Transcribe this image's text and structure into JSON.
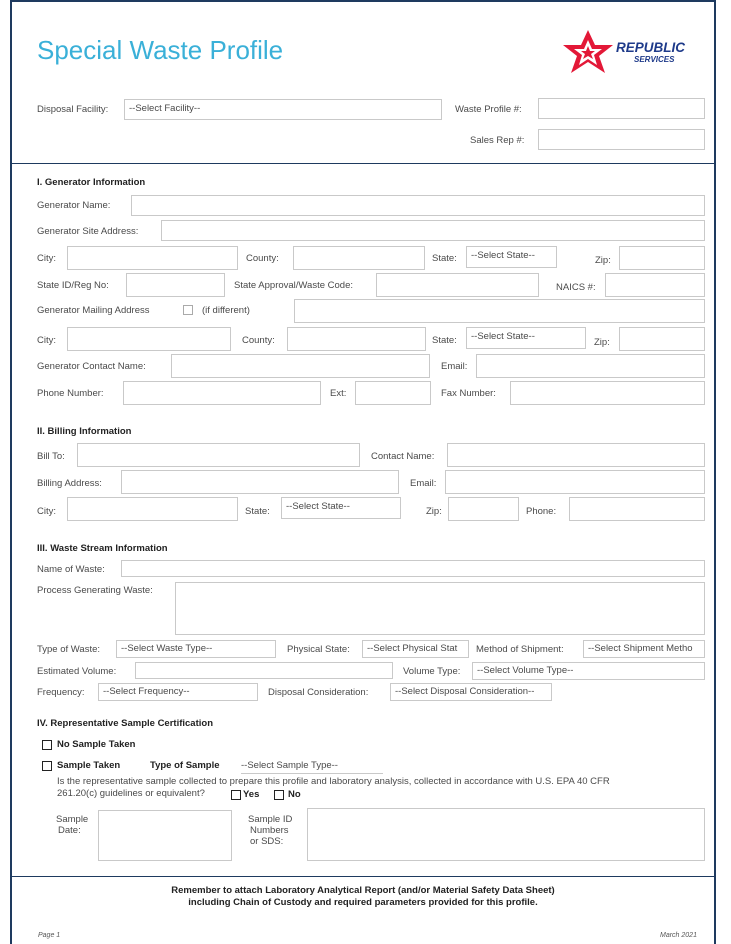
{
  "header": {
    "title": "Special Waste Profile",
    "logo_text_1": "REPUBLIC",
    "logo_text_2": "SERVICES",
    "disposal_facility_label": "Disposal Facility:",
    "disposal_facility_value": "--Select Facility--",
    "waste_profile_label": "Waste Profile #:",
    "sales_rep_label": "Sales Rep #:"
  },
  "generator": {
    "heading": "I. Generator Information",
    "name_label": "Generator Name:",
    "site_address_label": "Generator Site Address:",
    "city_label": "City:",
    "county_label": "County:",
    "state_label": "State:",
    "state_value": "--Select State--",
    "zip_label": "Zip:",
    "state_id_label": "State ID/Reg No:",
    "state_approval_label": "State Approval/Waste Code:",
    "naics_label": "NAICS #:",
    "mailing_label": "Generator Mailing Address",
    "if_different_label": "(if different)",
    "city2_label": "City:",
    "county2_label": "County:",
    "state2_label": "State:",
    "state2_value": "--Select State--",
    "zip2_label": "Zip:",
    "contact_label": "Generator Contact Name:",
    "email_label": "Email:",
    "phone_label": "Phone Number:",
    "ext_label": "Ext:",
    "fax_label": "Fax Number:"
  },
  "billing": {
    "heading": "II. Billing Information",
    "bill_to_label": "Bill To:",
    "contact_label": "Contact Name:",
    "address_label": "Billing Address:",
    "email_label": "Email:",
    "city_label": "City:",
    "state_label": "State:",
    "state_value": "--Select State--",
    "zip_label": "Zip:",
    "phone_label": "Phone:"
  },
  "waste_stream": {
    "heading": "III. Waste Stream Information",
    "name_label": "Name of Waste:",
    "process_label": "Process Generating Waste:",
    "type_label": "Type of Waste:",
    "type_value": "--Select Waste Type--",
    "physical_label": "Physical State:",
    "physical_value": "--Select Physical Stat",
    "shipment_label": "Method of Shipment:",
    "shipment_value": "--Select Shipment Metho",
    "volume_label": "Estimated Volume:",
    "volume_type_label": "Volume Type:",
    "volume_type_value": "--Select Volume Type--",
    "frequency_label": "Frequency:",
    "frequency_value": "--Select Frequency--",
    "disposal_label": "Disposal Consideration:",
    "disposal_value": "--Select Disposal Consideration--"
  },
  "sample": {
    "heading": "IV. Representative Sample Certification",
    "no_sample_label": "No Sample Taken",
    "sample_taken_label": "Sample Taken",
    "type_label": "Type of Sample",
    "type_value": "--Select Sample Type--",
    "question_line1": "Is the representative sample collected to prepare this profile and laboratory analysis, collected in accordance with U.S. EPA 40 CFR",
    "question_line2": "261.20(c) guidelines or equivalent?",
    "yes_label": "Yes",
    "no_label": "No",
    "date_label_1": "Sample",
    "date_label_2": "Date:",
    "id_label_1": "Sample ID",
    "id_label_2": "Numbers",
    "id_label_3": "or SDS:"
  },
  "footer": {
    "reminder_line1": "Remember to attach Laboratory Analytical Report (and/or Material Safety Data Sheet)",
    "reminder_line2": "including Chain of Custody and required parameters provided for this profile.",
    "page": "Page 1",
    "date": "March 2021"
  },
  "colors": {
    "title": "#3ab0d8",
    "brand_red": "#e31837",
    "brand_navy": "#1e3a8a",
    "frame": "#1e3a5f"
  }
}
